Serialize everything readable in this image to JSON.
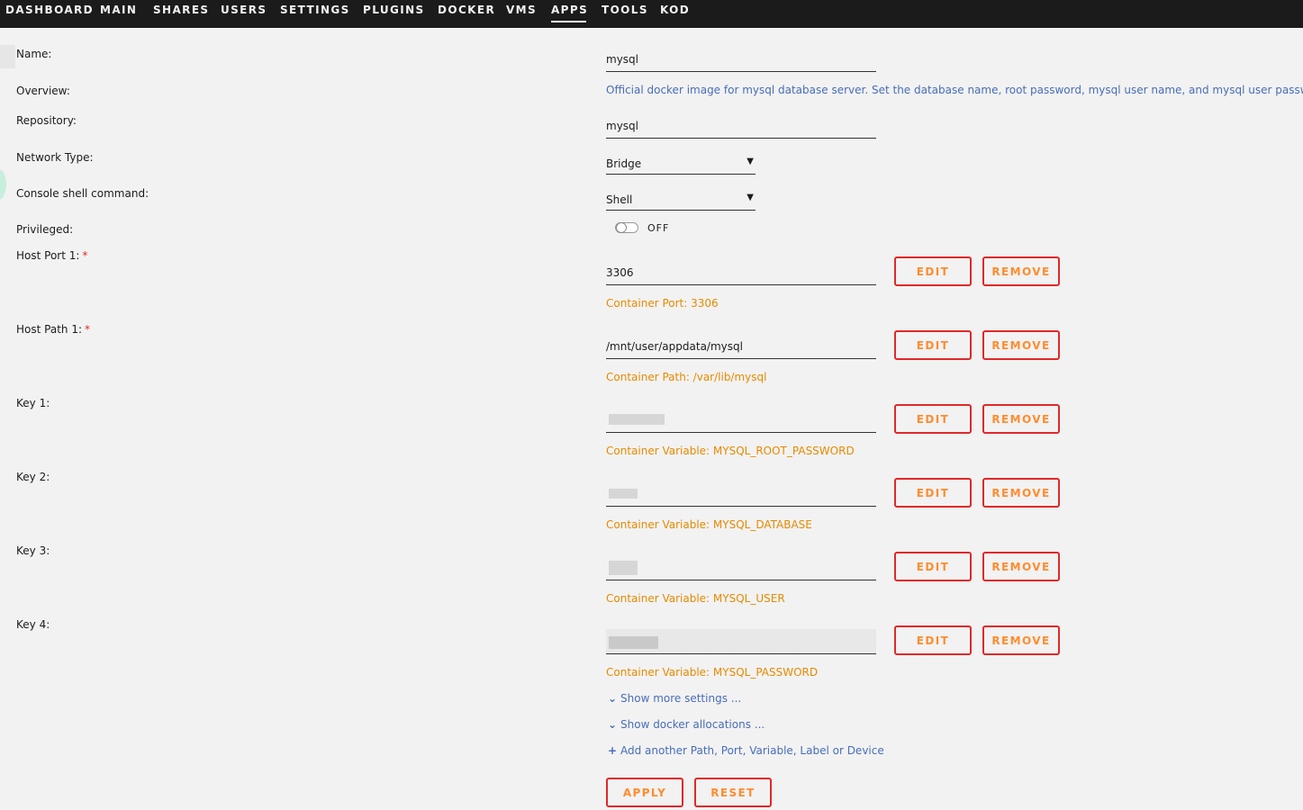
{
  "nav": {
    "items": [
      {
        "label": "DASHBOARD"
      },
      {
        "label": "MAIN"
      },
      {
        "label": "SHARES"
      },
      {
        "label": "USERS"
      },
      {
        "label": "SETTINGS"
      },
      {
        "label": "PLUGINS"
      },
      {
        "label": "DOCKER"
      },
      {
        "label": "VMS"
      },
      {
        "label": "APPS",
        "active": true
      },
      {
        "label": "TOOLS"
      },
      {
        "label": "KOD"
      }
    ]
  },
  "form": {
    "name": {
      "label": "Name:",
      "value": "mysql"
    },
    "overview": {
      "label": "Overview:",
      "text": "Official docker image for mysql database server. Set the database name, root password, mysql user name, and mysql user password."
    },
    "repository": {
      "label": "Repository:",
      "value": "mysql"
    },
    "network": {
      "label": "Network Type:",
      "value": "Bridge"
    },
    "console": {
      "label": "Console shell command:",
      "value": "Shell"
    },
    "privileged": {
      "label": "Privileged:",
      "state": "OFF"
    },
    "host_port_1": {
      "label": "Host Port 1:",
      "required": "*",
      "value": "3306",
      "hint": "Container Port: 3306"
    },
    "host_path_1": {
      "label": "Host Path 1:",
      "required": "*",
      "value": "/mnt/user/appdata/mysql",
      "hint": "Container Path: /var/lib/mysql"
    },
    "key_1": {
      "label": "Key 1:",
      "hint": "Container Variable: MYSQL_ROOT_PASSWORD"
    },
    "key_2": {
      "label": "Key 2:",
      "hint": "Container Variable: MYSQL_DATABASE"
    },
    "key_3": {
      "label": "Key 3:",
      "hint": "Container Variable: MYSQL_USER"
    },
    "key_4": {
      "label": "Key 4:",
      "hint": "Container Variable: MYSQL_PASSWORD"
    }
  },
  "buttons": {
    "edit": "EDIT",
    "remove": "REMOVE",
    "apply": "APPLY",
    "reset": "RESET"
  },
  "links": {
    "more_settings": "Show more settings ...",
    "docker_allocations": "Show docker allocations ...",
    "add_another": "Add another Path, Port, Variable, Label or Device"
  }
}
